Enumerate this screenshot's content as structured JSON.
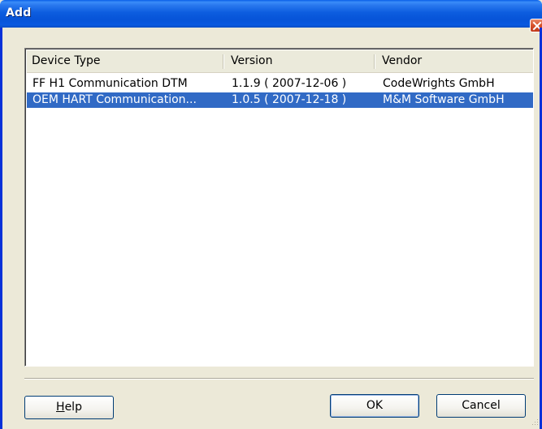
{
  "window": {
    "title": "Add"
  },
  "list": {
    "columns": [
      {
        "label": "Device Type"
      },
      {
        "label": "Version"
      },
      {
        "label": "Vendor"
      }
    ],
    "rows": [
      {
        "device_type": "FF H1 Communication DTM",
        "version": "1.1.9 ( 2007-12-06 )",
        "vendor": "CodeWrights GmbH",
        "selected": false
      },
      {
        "device_type": "OEM HART Communication...",
        "version": "1.0.5 ( 2007-12-18 )",
        "vendor": "M&M Software GmbH",
        "selected": true
      }
    ]
  },
  "buttons": {
    "help_mnemonic": "H",
    "help_rest": "elp",
    "ok": "OK",
    "cancel": "Cancel"
  },
  "colors": {
    "titlebar": "#0a5ae0",
    "selection": "#316ac5",
    "dialog_bg": "#ece9d8"
  },
  "icons": {
    "close": "close-icon",
    "resize": "resize-grip-icon"
  }
}
